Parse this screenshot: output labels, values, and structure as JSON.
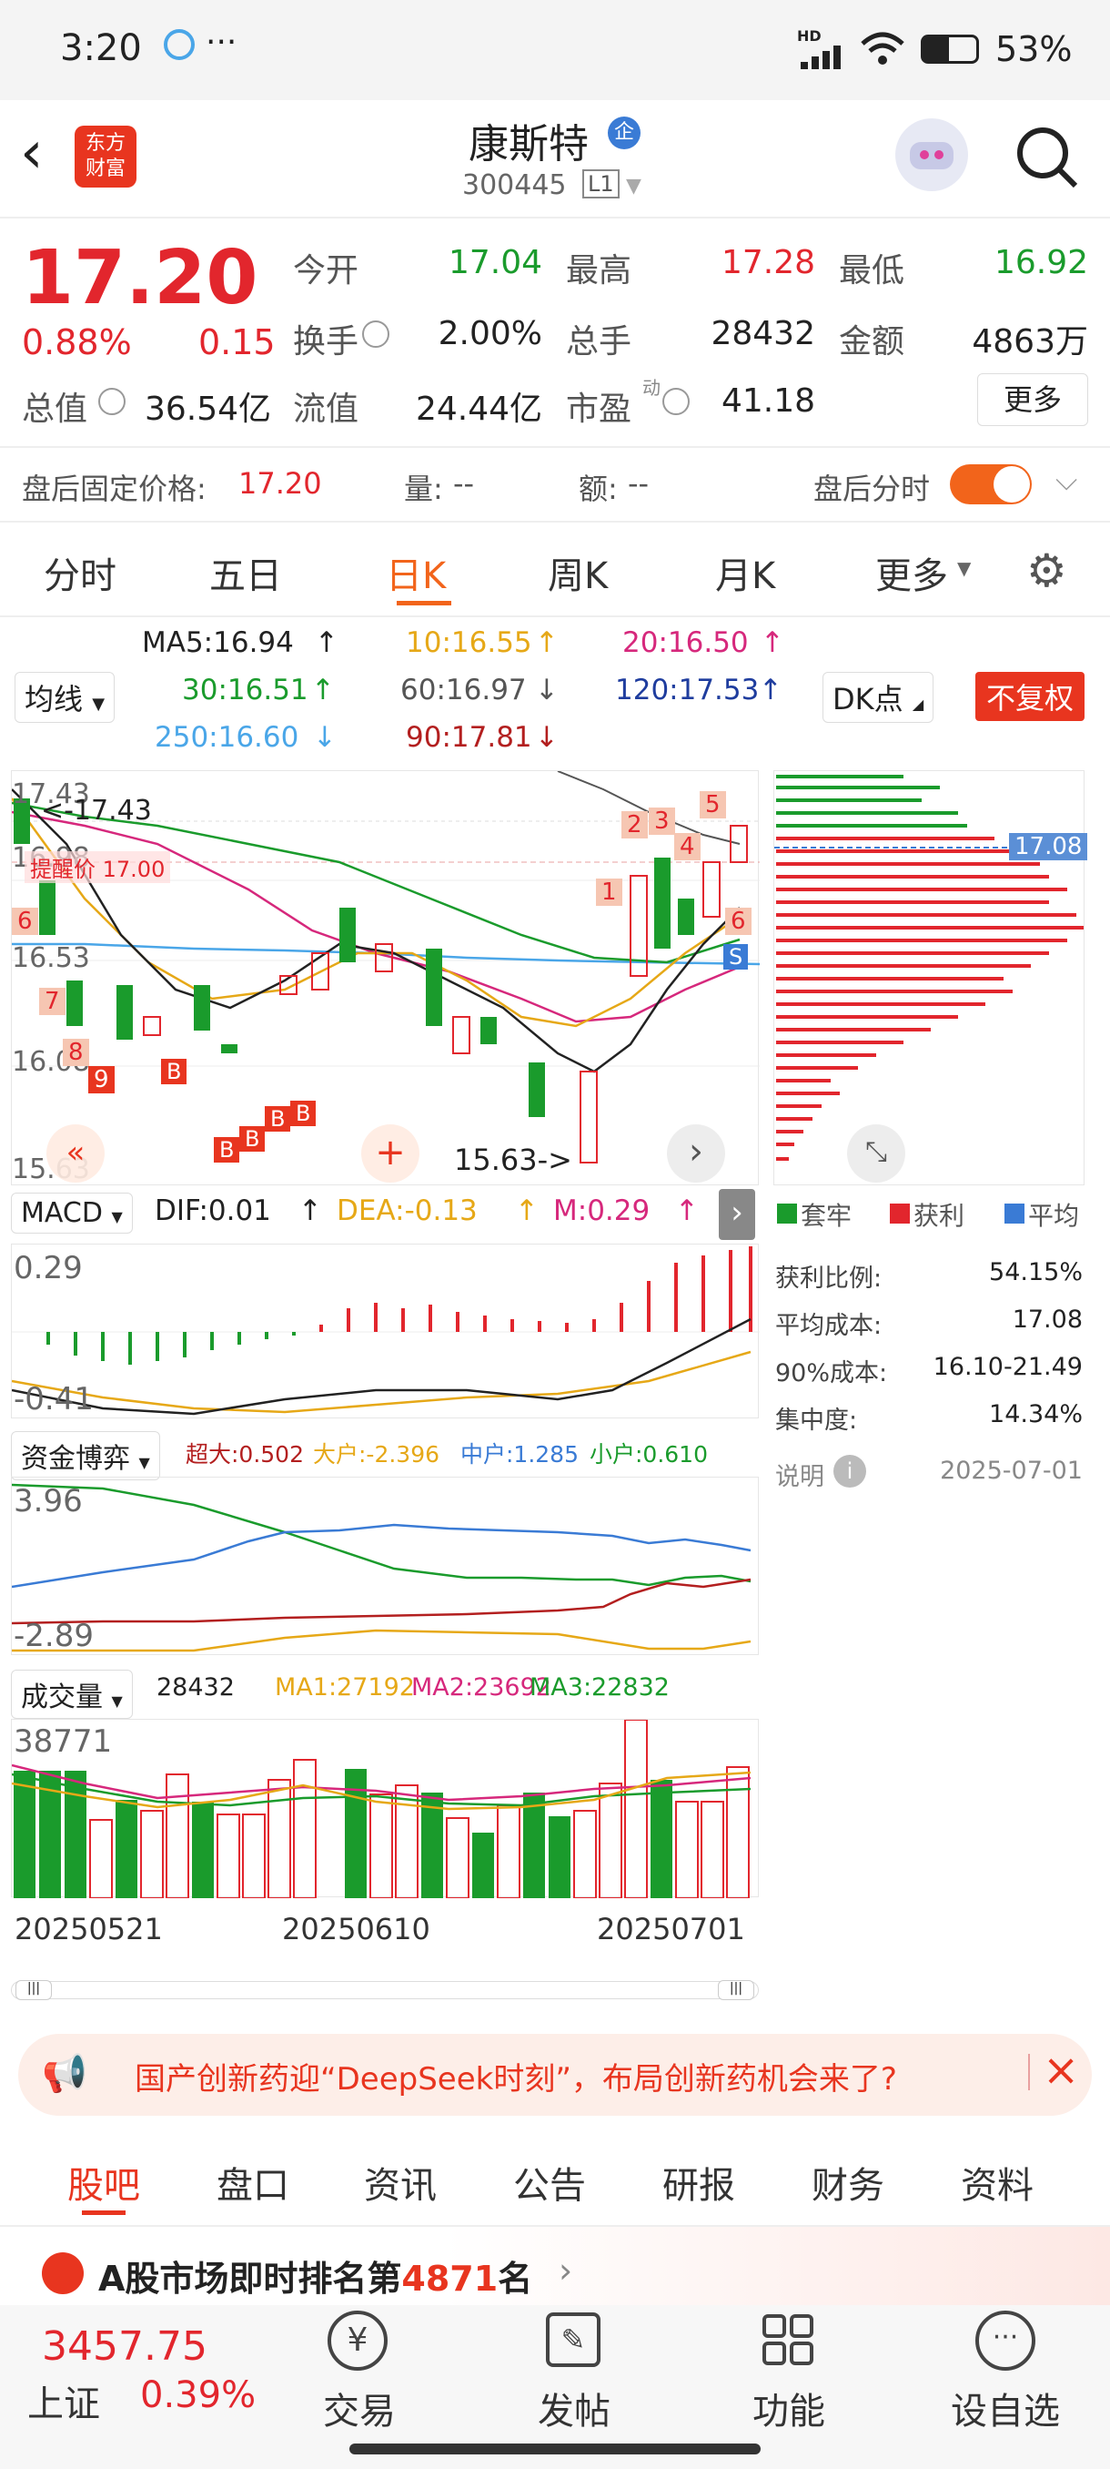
{
  "status_bar": {
    "time": "3:20",
    "dots": "···",
    "network": "HD",
    "battery": "53%"
  },
  "header": {
    "brand_line1": "东方",
    "brand_line2": "财富",
    "stock_name": "康斯特",
    "badge": "企",
    "stock_code": "300445",
    "level": "L1"
  },
  "quote": {
    "price": "17.20",
    "pct": "0.88%",
    "change": "0.15",
    "open_label": "今开",
    "open": "17.04",
    "high_label": "最高",
    "high": "17.28",
    "low_label": "最低",
    "low": "16.92",
    "turnover_label": "换手",
    "turnover": "2.00%",
    "volume_label": "总手",
    "volume": "28432",
    "amount_label": "金额",
    "amount": "4863万",
    "mcap_label": "总值",
    "mcap": "36.54亿",
    "float_label": "流值",
    "float": "24.44亿",
    "pe_label": "市盈",
    "pe_sup": "动",
    "pe": "41.18",
    "more": "更多"
  },
  "after_hours": {
    "fixed_label": "盘后固定价格:",
    "fixed_price": "17.20",
    "vol_label": "量:",
    "vol": "--",
    "amt_label": "额:",
    "amt": "--",
    "tick_label": "盘后分时"
  },
  "tabs": [
    "分时",
    "五日",
    "日K",
    "周K",
    "月K",
    "更多"
  ],
  "ma_legend": {
    "ma5": "MA5:16.94",
    "ma10": "10:16.55",
    "ma20": "20:16.50",
    "ma30": "30:16.51",
    "ma60": "60:16.97",
    "ma120": "120:17.53",
    "ma250": "250:16.60",
    "ma90": "90:17.81",
    "selector": "均线",
    "dk": "DK点",
    "fq": "不复权"
  },
  "kline": {
    "y_labels": [
      "17.43",
      "16.98",
      "16.53",
      "16.08",
      "15.63"
    ],
    "high_note": "<-17.43",
    "low_note": "15.63->",
    "remind": "提醒价 17.00",
    "buy": "B",
    "sell": "S",
    "numbers": [
      "1",
      "2",
      "3",
      "4",
      "5",
      "6",
      "6",
      "7",
      "8",
      "9"
    ]
  },
  "chip": {
    "price_tag": "17.08",
    "legend": [
      "套牢",
      "获利",
      "平均"
    ],
    "rows": [
      {
        "k": "获利比例:",
        "v": "54.15%"
      },
      {
        "k": "平均成本:",
        "v": "17.08"
      },
      {
        "k": "90%成本:",
        "v": "16.10-21.49"
      },
      {
        "k": "集中度:",
        "v": "14.34%"
      }
    ],
    "note": "说明",
    "date": "2025-07-01"
  },
  "macd": {
    "selector": "MACD",
    "dif": "DIF:0.01",
    "dea": "DEA:-0.13",
    "m": "M:0.29",
    "top": "0.29",
    "bottom": "-0.41"
  },
  "fund": {
    "selector": "资金博弈",
    "super": "超大:0.502",
    "big": "大户:-2.396",
    "mid": "中户:1.285",
    "small": "小户:0.610",
    "top": "3.96",
    "bottom": "-2.89"
  },
  "volume": {
    "selector": "成交量",
    "v": "28432",
    "ma1": "MA1:27192",
    "ma2": "MA2:23692",
    "ma3": "MA3:22832",
    "top": "38771",
    "dates": [
      "20250521",
      "20250610",
      "20250701"
    ]
  },
  "banner": {
    "text": "国产创新药迎“DeepSeek时刻”，布局创新药机会来了?"
  },
  "subtabs": [
    "股吧",
    "盘口",
    "资讯",
    "公告",
    "研报",
    "财务",
    "资料"
  ],
  "rank": {
    "prefix": "A股市场即时排名第",
    "num": "4871",
    "suffix": "名"
  },
  "bottom": {
    "index_val": "3457.75",
    "index_name": "上证",
    "index_pct": "0.39%",
    "nav": [
      "交易",
      "发帖",
      "功能",
      "设自选"
    ]
  },
  "colors": {
    "red": "#e2262d",
    "green": "#1a9b2c",
    "orange": "#f2641b",
    "blue": "#3a7bd5"
  }
}
